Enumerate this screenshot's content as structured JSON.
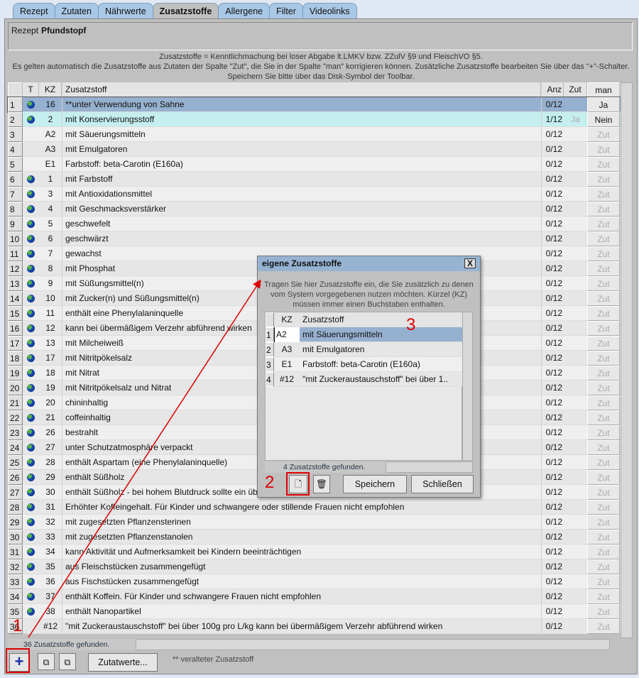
{
  "tabs": [
    "Rezept",
    "Zutaten",
    "Nährwerte",
    "Zusatzstoffe",
    "Allergene",
    "Filter",
    "Videolinks"
  ],
  "recipe": {
    "label": "Rezept",
    "name": "Pfundstopf"
  },
  "info": [
    "Zusatzstoffe = Kenntlichmachung bei loser Abgabe lt.LMKV bzw. ZZulV §9 und FleischVO §5.",
    "Es gelten automatisch die Zusatzstoffe aus Zutaten der Spalte \"Zut\", die Sie in der Spalte \"man\" korrigieren können. Zusätzliche Zusatzstoffe bearbeiten Sie über das \"+\"-Schalter.",
    "Speichern Sie bitte über das Disk-Symbol der Toolbar."
  ],
  "columns": {
    "t": "T",
    "kz": "KZ",
    "name": "Zusatzstoff",
    "anz": "Anz",
    "zut": "Zut",
    "man": "man"
  },
  "rows": [
    [
      "1",
      true,
      "16",
      "**unter Verwendung von Sahne",
      "0/12",
      "",
      "Ja"
    ],
    [
      "2",
      true,
      "2",
      "mit Konservierungsstoff",
      "1/12",
      "Ja",
      "Nein"
    ],
    [
      "3",
      false,
      "A2",
      "mit Säuerungsmitteln",
      "0/12",
      "",
      "Zut"
    ],
    [
      "4",
      false,
      "A3",
      "mit Emulgatoren",
      "0/12",
      "",
      "Zut"
    ],
    [
      "5",
      false,
      "E1",
      "Farbstoff: beta-Carotin (E160a)",
      "0/12",
      "",
      "Zut"
    ],
    [
      "6",
      true,
      "1",
      "mit Farbstoff",
      "0/12",
      "",
      "Zut"
    ],
    [
      "7",
      true,
      "3",
      "mit Antioxidationsmittel",
      "0/12",
      "",
      "Zut"
    ],
    [
      "8",
      true,
      "4",
      "mit Geschmacksverstärker",
      "0/12",
      "",
      "Zut"
    ],
    [
      "9",
      true,
      "5",
      "geschwefelt",
      "0/12",
      "",
      "Zut"
    ],
    [
      "10",
      true,
      "6",
      "geschwärzt",
      "0/12",
      "",
      "Zut"
    ],
    [
      "11",
      true,
      "7",
      "gewachst",
      "0/12",
      "",
      "Zut"
    ],
    [
      "12",
      true,
      "8",
      "mit Phosphat",
      "0/12",
      "",
      "Zut"
    ],
    [
      "13",
      true,
      "9",
      "mit Süßungsmittel(n)",
      "0/12",
      "",
      "Zut"
    ],
    [
      "14",
      true,
      "10",
      "mit Zucker(n) und Süßungsmittel(n)",
      "0/12",
      "",
      "Zut"
    ],
    [
      "15",
      true,
      "11",
      "enthält eine Phenylalaninquelle",
      "0/12",
      "",
      "Zut"
    ],
    [
      "16",
      true,
      "12",
      "kann bei übermäßigem Verzehr abführend wirken",
      "0/12",
      "",
      "Zut"
    ],
    [
      "17",
      true,
      "13",
      "mit Milcheiweiß",
      "0/12",
      "",
      "Zut"
    ],
    [
      "18",
      true,
      "17",
      "mit Nitritpökelsalz",
      "0/12",
      "",
      "Zut"
    ],
    [
      "19",
      true,
      "18",
      "mit Nitrat",
      "0/12",
      "",
      "Zut"
    ],
    [
      "20",
      true,
      "19",
      "mit Nitritpökelsalz und Nitrat",
      "0/12",
      "",
      "Zut"
    ],
    [
      "21",
      true,
      "20",
      "chininhaltig",
      "0/12",
      "",
      "Zut"
    ],
    [
      "22",
      true,
      "21",
      "coffeinhaltig",
      "0/12",
      "",
      "Zut"
    ],
    [
      "23",
      true,
      "26",
      "bestrahlt",
      "0/12",
      "",
      "Zut"
    ],
    [
      "24",
      true,
      "27",
      "unter Schutzatmosphäre verpackt",
      "0/12",
      "",
      "Zut"
    ],
    [
      "25",
      true,
      "28",
      "enthält Aspartam (eine Phenylalaninquelle)",
      "0/12",
      "",
      "Zut"
    ],
    [
      "26",
      true,
      "29",
      "enthält Süßholz",
      "0/12",
      "",
      "Zut"
    ],
    [
      "27",
      true,
      "30",
      "enthält Süßholz - bei hohem Blutdruck sollte ein übermäßiger Verzehr vermieden werden",
      "0/12",
      "",
      "Zut"
    ],
    [
      "28",
      true,
      "31",
      "Erhöhter Koffeingehalt. Für Kinder und schwangere oder stillende Frauen nicht empfohlen",
      "0/12",
      "",
      "Zut"
    ],
    [
      "29",
      true,
      "32",
      "mit zugesetzten Pflanzensterinen",
      "0/12",
      "",
      "Zut"
    ],
    [
      "30",
      true,
      "33",
      "mit zugesetzten Pflanzenstanolen",
      "0/12",
      "",
      "Zut"
    ],
    [
      "31",
      true,
      "34",
      "kann Aktivität und Aufmerksamkeit bei Kindern beeinträchtigen",
      "0/12",
      "",
      "Zut"
    ],
    [
      "32",
      true,
      "35",
      "aus Fleischstücken zusammengefügt",
      "0/12",
      "",
      "Zut"
    ],
    [
      "33",
      true,
      "36",
      "aus Fischstücken zusammengefügt",
      "0/12",
      "",
      "Zut"
    ],
    [
      "34",
      true,
      "37",
      "enthält Koffein. Für Kinder und schwangere Frauen nicht empfohlen",
      "0/12",
      "",
      "Zut"
    ],
    [
      "35",
      true,
      "38",
      "enthält Nanopartikel",
      "0/12",
      "",
      "Zut"
    ],
    [
      "36",
      false,
      "#12",
      "\"mit Zuckeraustauschstoff\" bei über 100g pro L/kg kann bei übermäßigem Verzehr abführend wirken",
      "0/12",
      "",
      "Zut"
    ]
  ],
  "status": "36  Zusatzstoffe gefunden.",
  "buttons": {
    "add": "+",
    "zutatwerte": "Zutatwerte..."
  },
  "legend": "** veralteter Zusatzstoff",
  "dialog": {
    "title": "eigene Zusatzstoffe",
    "close": "X",
    "info": "Tragen Sie hier Zusatzstoffe ein, die Sie zusätzlich zu denen vom System vorgegebenen nutzen möchten. Kürzel (KZ) müssen immer einen Buchstaben enthalten.",
    "columns": {
      "kz": "KZ",
      "name": "Zusatzstoff"
    },
    "rows": [
      [
        "1",
        "A2",
        "mit Säuerungsmitteln"
      ],
      [
        "2",
        "A3",
        "mit Emulgatoren"
      ],
      [
        "3",
        "E1",
        "Farbstoff: beta-Carotin (E160a)"
      ],
      [
        "4",
        "#12",
        "\"mit Zuckeraustauschstoff\" bei über 1.."
      ]
    ],
    "status": "4  Zusatzstoffe gefunden.",
    "save": "Speichern",
    "closeBtn": "Schließen"
  },
  "annotations": [
    "1",
    "2",
    "3"
  ],
  "colors": {
    "selected": "#96b0cf",
    "highlight": "#c5eeee",
    "annotation": "#dd0000"
  }
}
